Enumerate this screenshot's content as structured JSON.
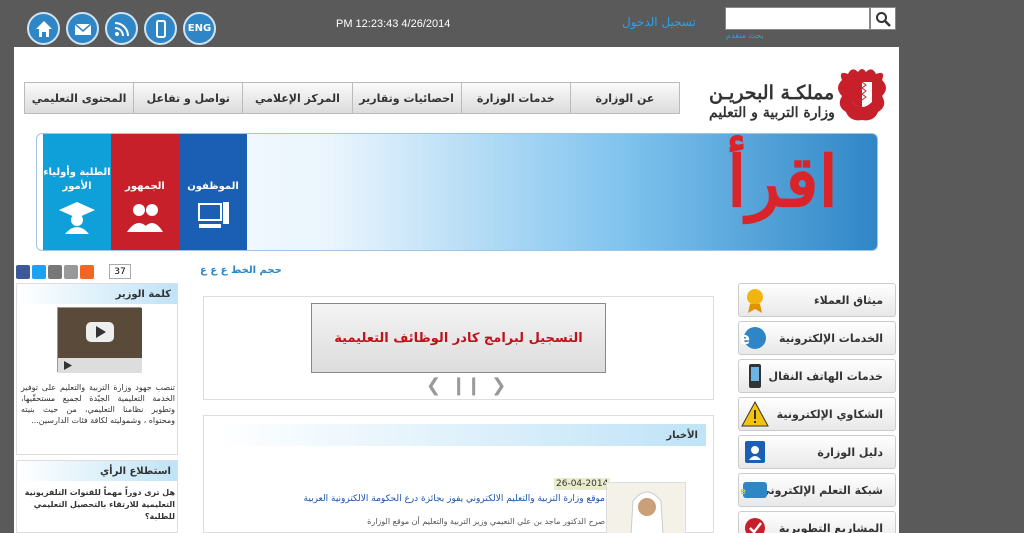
{
  "header": {
    "datetime": "PM 12:23:43 4/26/2014",
    "login": "تسجيل الدخول",
    "advanced_search": "بحث متقدم",
    "search_placeholder": "",
    "lang": "ENG"
  },
  "logo": {
    "line1": "مملكـة البحريـن",
    "line2": "وزارة التربية و التعليم"
  },
  "nav": {
    "items": [
      "عن الوزارة",
      "خدمات الوزارة",
      "احصائيات وتقارير",
      "المركز الإعلامي",
      "تواصل و تفاعل",
      "المحتوى التعليمي"
    ]
  },
  "banner": {
    "tiles": [
      "الموظفون",
      "الجمهور",
      "الطلبة وأولياء الأمور"
    ],
    "brand": "اقرأ"
  },
  "share": {
    "count": "37",
    "fontsize_label": "حجم الخط ع ع ع"
  },
  "rmenu": {
    "items": [
      "ميثاق العملاء",
      "الخدمات الإلكترونية",
      "خدمات الهاتف النقال",
      "الشكاوي الإلكترونية",
      "دليل الوزارة",
      "شبكة التعلم الإلكتروني",
      "المشاريع التطويرية"
    ]
  },
  "slider": {
    "text": "التسجيل لبرامج كادر الوظائف التعليمية"
  },
  "news": {
    "head": "الأخبار",
    "date": "26-04-2014",
    "title": "موقع وزارة التربية والتعليم الالكتروني يفوز بجائزة درع الحكومة الالكترونية العربية",
    "body": "صرح الدكتور ماجد بن علي النعيمي وزير التربية والتعليم أن موقع الوزارة"
  },
  "left": {
    "minister_head": "كلمة الوزير",
    "minister_text": "تنصب جهود وزارة التربية والتعليم على توفير الخدمة التعليمية الجيّدة لجميع مستحقّيها، وتطوير نظامنا التعليمي، من حيث بنيته ومحتواه ، وشموليته لكافة فئات الدارسين...",
    "poll_head": "استطلاع الرأي",
    "poll_question": "هل ترى دوراً مهماً للقنوات التلفزيونية التعليمية للارتقاء بالتحصيل التعليمي للطلبة؟"
  }
}
